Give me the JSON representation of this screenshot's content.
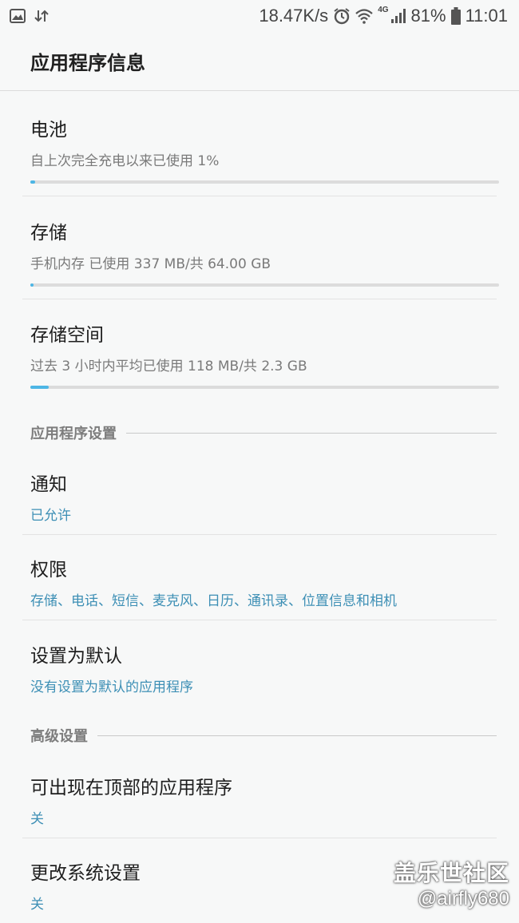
{
  "status_bar": {
    "speed": "18.47K/s",
    "network_type": "4G",
    "battery": "81%",
    "time": "11:01",
    "icons": [
      "gallery-icon",
      "data-transfer-icon",
      "alarm-icon",
      "wifi-icon",
      "signal-icon",
      "battery-icon"
    ]
  },
  "header": {
    "title": "应用程序信息"
  },
  "usage": [
    {
      "title": "电池",
      "subtitle": "自上次完全充电以来已使用 1%",
      "progress": 0.01
    },
    {
      "title": "存储",
      "subtitle": "手机内存 已使用 337 MB/共 64.00 GB",
      "progress": 0.005
    },
    {
      "title": "存储空间",
      "subtitle": "过去 3 小时内平均已使用 118 MB/共 2.3 GB",
      "progress": 0.04
    }
  ],
  "app_settings": {
    "section_label": "应用程序设置",
    "items": [
      {
        "title": "通知",
        "subtitle": "已允许"
      },
      {
        "title": "权限",
        "subtitle": "存储、电话、短信、麦克风、日历、通讯录、位置信息和相机"
      },
      {
        "title": "设置为默认",
        "subtitle": "没有设置为默认的应用程序"
      }
    ]
  },
  "advanced_settings": {
    "section_label": "高级设置",
    "items": [
      {
        "title": "可出现在顶部的应用程序",
        "subtitle": "关"
      },
      {
        "title": "更改系统设置",
        "subtitle": "关"
      }
    ]
  },
  "watermark": {
    "line1": "盖乐世社区",
    "line2": "@airfly680"
  },
  "colors": {
    "accent": "#4db6e5",
    "link_text": "#3d8fb5",
    "background": "#f7f8f8"
  }
}
